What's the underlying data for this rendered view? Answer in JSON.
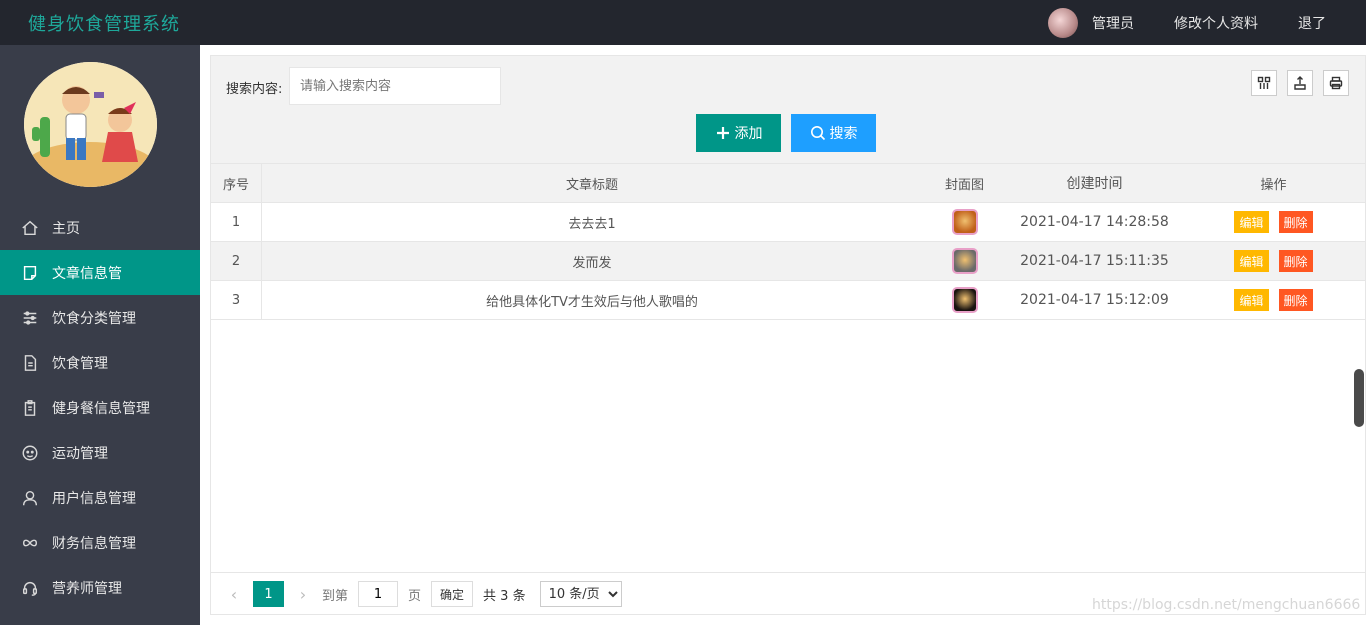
{
  "app": {
    "title": "健身饮食管理系统"
  },
  "topbar": {
    "user": "管理员",
    "edit_profile": "修改个人资料",
    "logout": "退了"
  },
  "sidebar": {
    "items": [
      {
        "label": "主页",
        "icon": "home-icon",
        "active": false
      },
      {
        "label": "文章信息管",
        "icon": "article-icon",
        "active": true
      },
      {
        "label": "饮食分类管理",
        "icon": "sliders-icon",
        "active": false
      },
      {
        "label": "饮食管理",
        "icon": "document-icon",
        "active": false
      },
      {
        "label": "健身餐信息管理",
        "icon": "clipboard-icon",
        "active": false
      },
      {
        "label": "运动管理",
        "icon": "face-icon",
        "active": false
      },
      {
        "label": "用户信息管理",
        "icon": "user-icon",
        "active": false
      },
      {
        "label": "财务信息管理",
        "icon": "infinity-icon",
        "active": false
      },
      {
        "label": "营养师管理",
        "icon": "headset-icon",
        "active": false
      }
    ]
  },
  "search": {
    "label": "搜索内容:",
    "placeholder": "请输入搜索内容"
  },
  "buttons": {
    "add": "添加",
    "search": "搜索"
  },
  "toolbar_icons": [
    "columns-icon",
    "export-icon",
    "print-icon"
  ],
  "table": {
    "headers": [
      "序号",
      "文章标题",
      "封面图",
      "创建时间",
      "操作"
    ],
    "rows": [
      {
        "idx": "1",
        "title": "去去去1",
        "time": "2021-04-17 14:28:58",
        "thumb_color": "#c0601a"
      },
      {
        "idx": "2",
        "title": "发而发",
        "time": "2021-04-17 15:11:35",
        "thumb_color": "#6a6a6a"
      },
      {
        "idx": "3",
        "title": "给他具体化TV才生效后与他人歌唱的",
        "time": "2021-04-17 15:12:09",
        "thumb_color": "#1a1410"
      }
    ],
    "edit_label": "编辑",
    "delete_label": "删除"
  },
  "pager": {
    "current": "1",
    "goto_label": "到第",
    "page_value": "1",
    "page_unit": "页",
    "confirm": "确定",
    "total": "共 3 条",
    "page_size": "10 条/页"
  },
  "watermark": "https://blog.csdn.net/mengchuan6666",
  "colors": {
    "accent": "#009688",
    "search_blue": "#1e9fff",
    "edit": "#ffb800",
    "delete": "#ff5722",
    "sidebar": "#393d49",
    "topbar": "#23262e"
  }
}
